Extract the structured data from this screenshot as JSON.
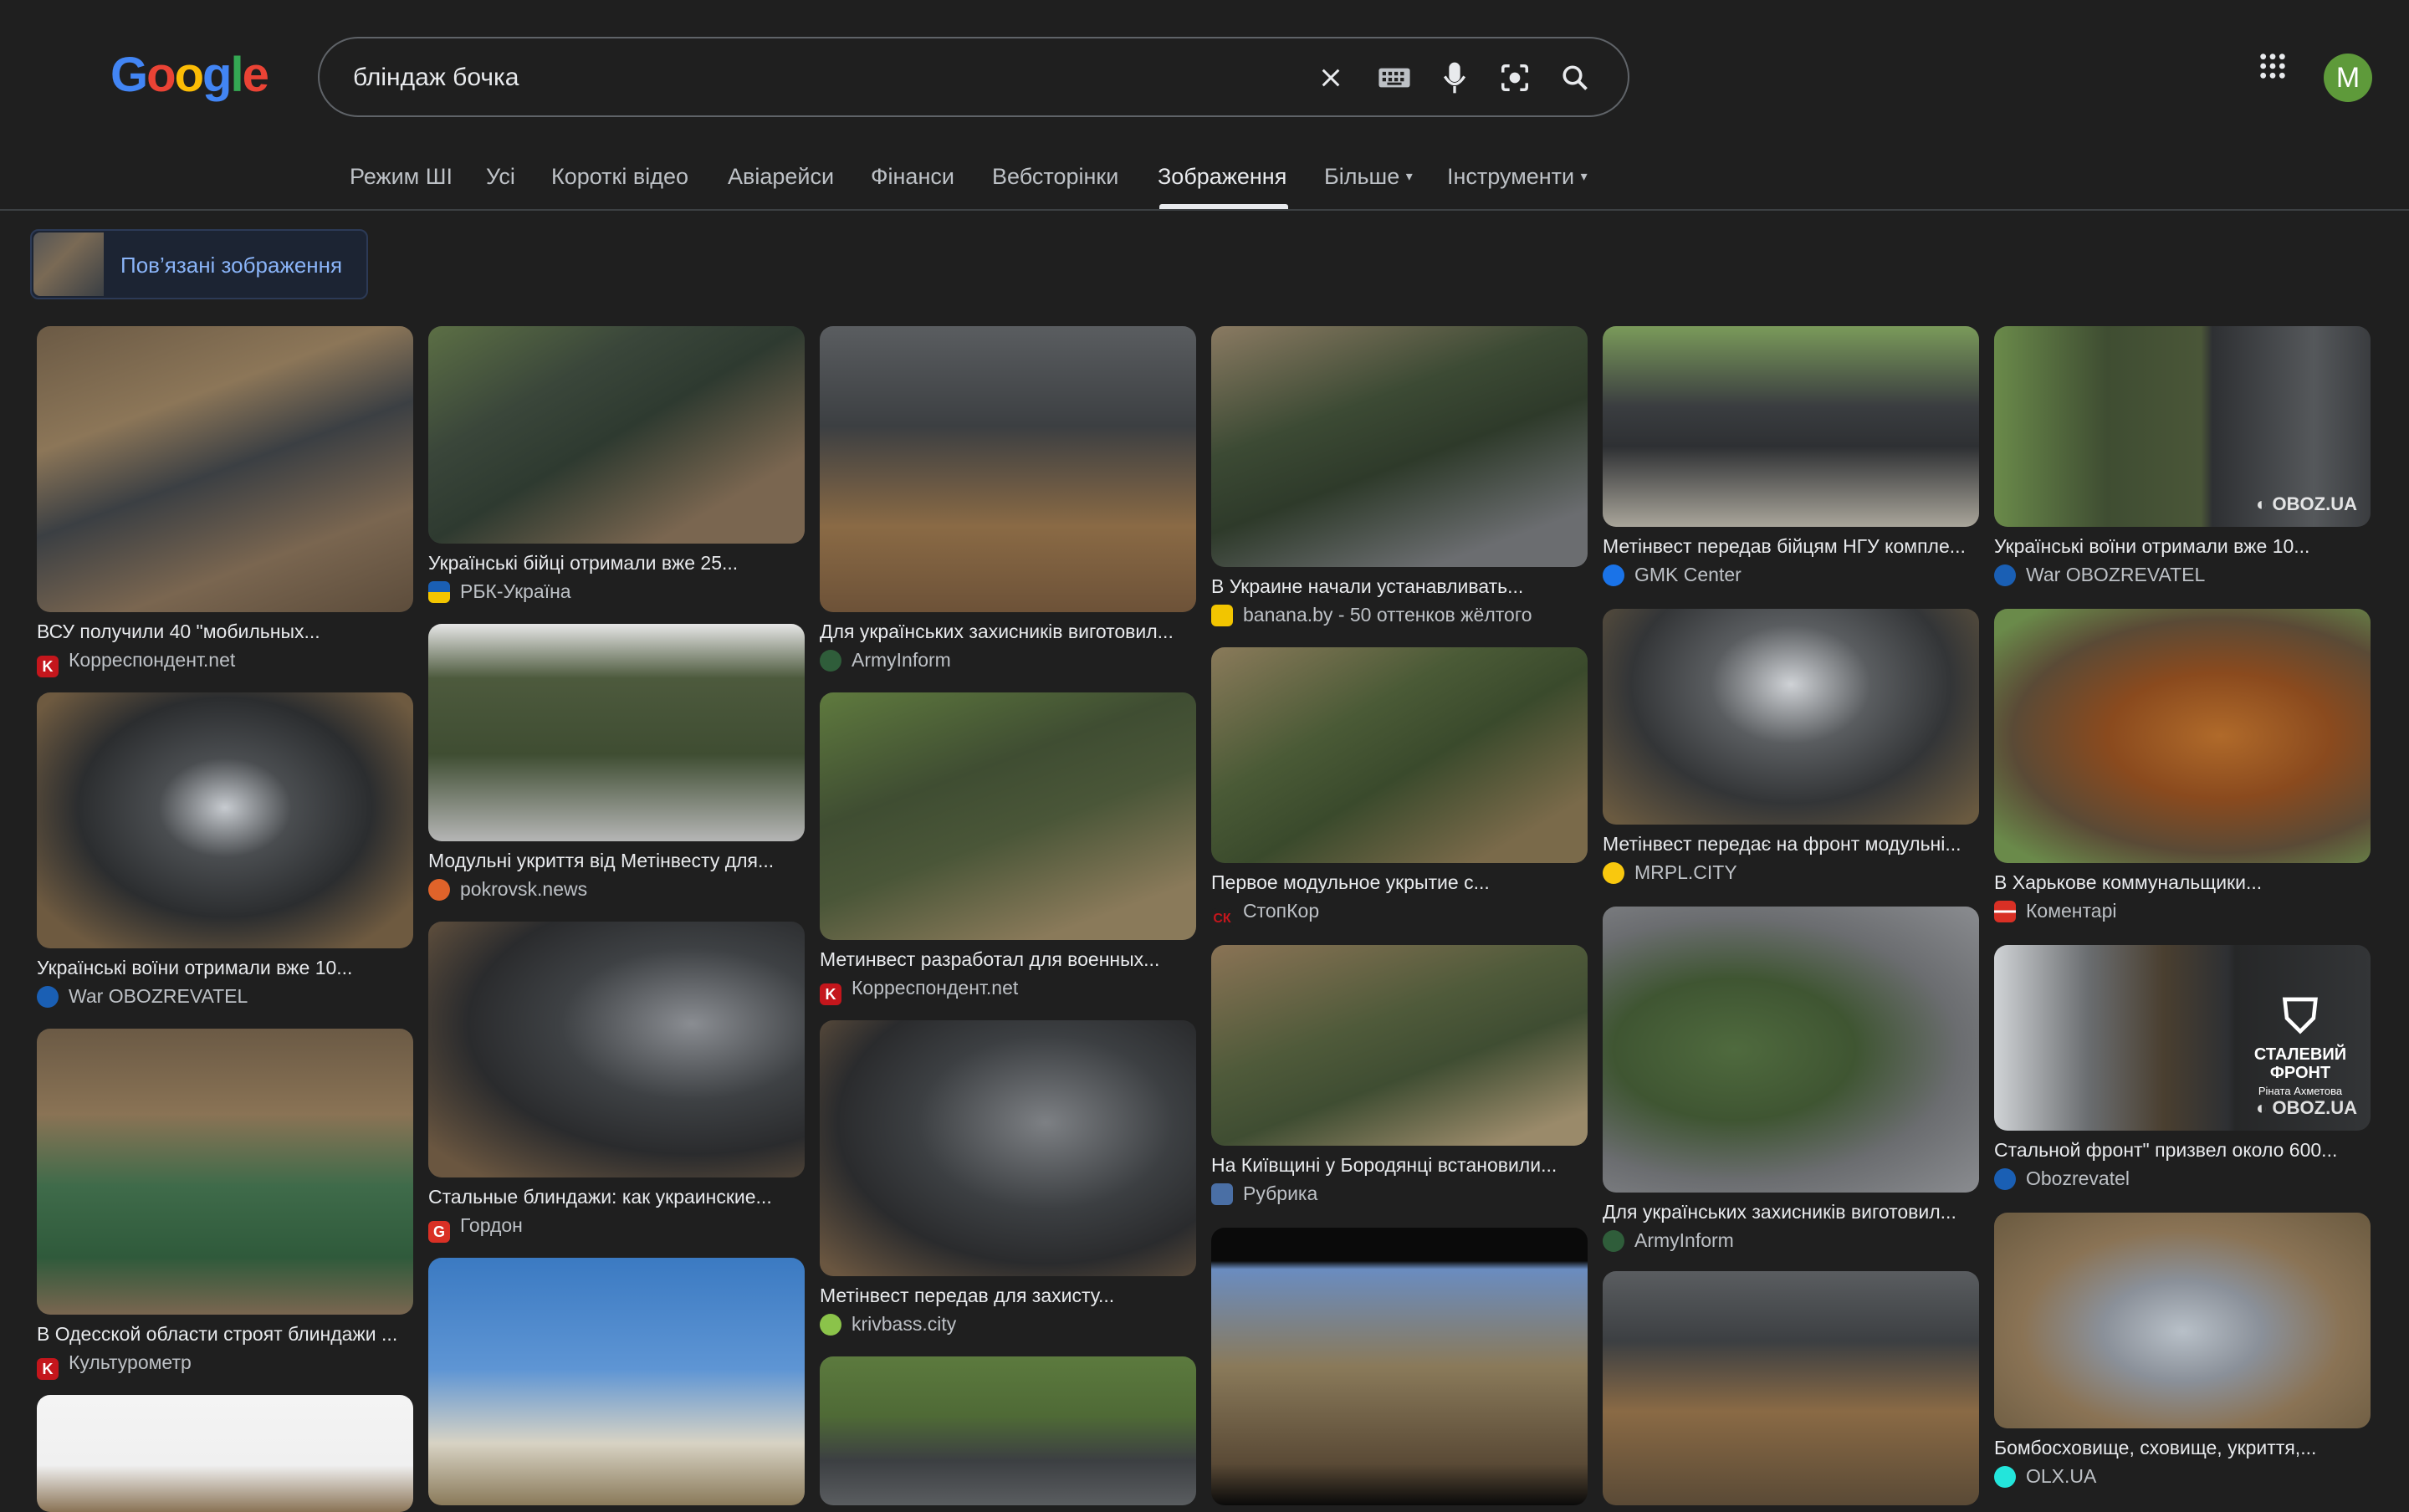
{
  "search": {
    "query": "бліндаж бочка"
  },
  "logo": {
    "letters": [
      "G",
      "o",
      "o",
      "g",
      "l",
      "e"
    ]
  },
  "avatar": {
    "initial": "M",
    "color": "#5e9a3a"
  },
  "tabs": [
    "Режим ШІ",
    "Усі",
    "Короткі відео",
    "Авіарейси",
    "Фінанси",
    "Вебсторінки",
    "Зображення",
    "Більше",
    "Інструменти"
  ],
  "related": {
    "label": "Пов’язані зображення"
  },
  "results": [
    {
      "title": "ВСУ получили 40 \"мобильных...",
      "source": "Корреспондент.net",
      "fav": "#c4161c",
      "fav_text": "K"
    },
    {
      "title": "Українські воїни отримали вже 10...",
      "source": "War OBOZREVATEL",
      "fav": "#1a5fb4",
      "fav_text": ""
    },
    {
      "title": "В Одесской области строят блиндажи ...",
      "source": "Культурометр",
      "fav": "#c4161c",
      "fav_text": "K"
    },
    {
      "title": "Українські бійці отримали вже 25...",
      "source": "РБК-Україна",
      "fav": "#f2c500",
      "fav_text": ""
    },
    {
      "title": "Модульні укриття від Метінвесту для...",
      "source": "pokrovsk.news",
      "fav": "#e0632a",
      "fav_text": ""
    },
    {
      "title": "Стальные блиндажи: как украинские...",
      "source": "Гордон",
      "fav": "#d93025",
      "fav_text": "G"
    },
    {
      "title": "Для українських захисників виготовил...",
      "source": "ArmyInform",
      "fav": "#2f5d3a",
      "fav_text": ""
    },
    {
      "title": "Метинвест разработал для военных...",
      "source": "Корреспондент.net",
      "fav": "#c4161c",
      "fav_text": "K"
    },
    {
      "title": "Метінвест передав для захисту...",
      "source": "krivbass.city",
      "fav": "#8bc34a",
      "fav_text": ""
    },
    {
      "title": "В Украине начали устанавливать...",
      "source": "banana.by - 50 оттенков жёлтого",
      "fav": "#f2c500",
      "fav_text": ""
    },
    {
      "title": "Первое модульное укрытие с...",
      "source": "СтопКор",
      "fav": "#c4161c",
      "fav_text": "СК"
    },
    {
      "title": "На Київщині у Бородянці встановили...",
      "source": "Рубрика",
      "fav": "#4a6fa5",
      "fav_text": ""
    },
    {
      "title": "Метінвест передав бійцям НГУ компле...",
      "source": "GMK Center",
      "fav": "#1a73e8",
      "fav_text": ""
    },
    {
      "title": "Метінвест передає на фронт модульні...",
      "source": "MRPL.CITY",
      "fav": "#f9c80e",
      "fav_text": ""
    },
    {
      "title": "Для українських захисників виготовил...",
      "source": "ArmyInform",
      "fav": "#2f5d3a",
      "fav_text": ""
    },
    {
      "title": "Українські воїни отримали вже 10...",
      "source": "War OBOZREVATEL",
      "fav": "#1a5fb4",
      "fav_text": ""
    },
    {
      "title": "В Харькове коммунальщики...",
      "source": "Коментарі",
      "fav": "#d93025",
      "fav_text": ""
    },
    {
      "title": "Стальной фронт\" призвел около 600...",
      "source": "Obozrevatel",
      "fav": "#1a5fb4",
      "fav_text": ""
    },
    {
      "title": "Бомбосховище, сховище, укриття,...",
      "source": "OLX.UA",
      "fav": "#23e5db",
      "fav_text": ""
    }
  ],
  "watermarks": {
    "oboz": "OBOZ.UA",
    "front": "СТАЛЕВИЙ ФРОНТ",
    "front_sub": "Ріната Ахметова"
  }
}
